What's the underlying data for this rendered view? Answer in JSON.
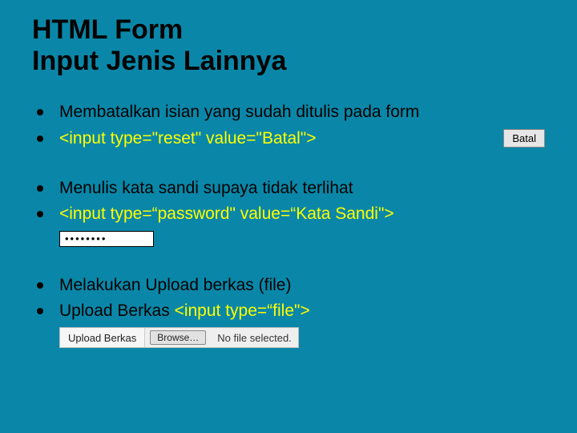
{
  "title_line1": "HTML Form",
  "title_line2": "Input Jenis Lainnya",
  "section1": {
    "line1": "Membatalkan isian yang sudah ditulis pada form",
    "line2": "<input type=\"reset\" value=\"Batal\">",
    "button_label": "Batal"
  },
  "section2": {
    "line1": "Menulis kata sandi supaya tidak terlihat",
    "line2": "<input type=“password\" value=“Kata Sandi\">",
    "password_dots": "••••••••"
  },
  "section3": {
    "line1": "Melakukan Upload berkas (file)",
    "line2_prefix": "Upload Berkas ",
    "line2_code": "<input type=“file\">",
    "upload_label": "Upload Berkas",
    "browse_label": "Browse…",
    "no_file_text": "No file selected."
  }
}
